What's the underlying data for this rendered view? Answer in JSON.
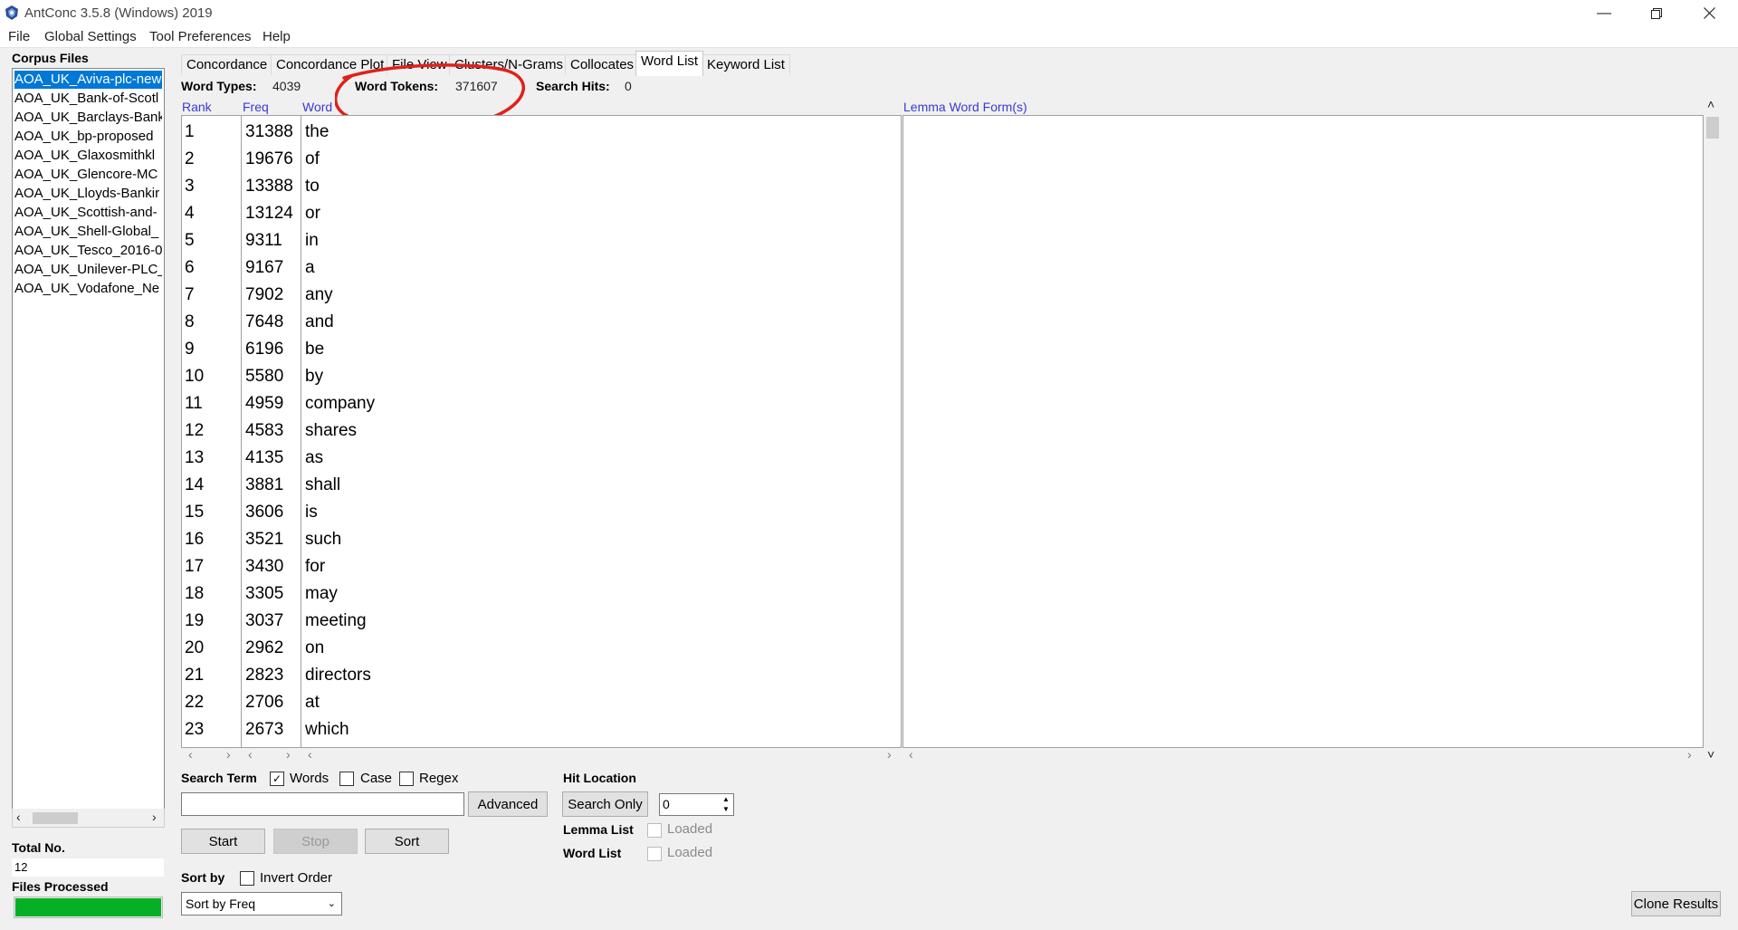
{
  "window": {
    "title": "AntConc 3.5.8 (Windows) 2019",
    "controls": [
      "minimize",
      "restore",
      "close"
    ]
  },
  "menu": [
    "File",
    "Global Settings",
    "Tool Preferences",
    "Help"
  ],
  "corpus": {
    "title": "Corpus Files",
    "files": [
      "AOA_UK_Aviva-plc-new",
      "AOA_UK_Bank-of-Scotl",
      "AOA_UK_Barclays-Bank",
      "AOA_UK_bp-proposed",
      "AOA_UK_Glaxosmithkl",
      "AOA_UK_Glencore-MC",
      "AOA_UK_Lloyds-Bankir",
      "AOA_UK_Scottish-and-",
      "AOA_UK_Shell-Global_",
      "AOA_UK_Tesco_2016-0",
      "AOA_UK_Unilever-PLC_",
      "AOA_UK_Vodafone_Ne"
    ],
    "selected_index": 0,
    "total_label": "Total No.",
    "total_value": "12",
    "files_processed_label": "Files Processed",
    "progress": 1.0
  },
  "tabs": [
    "Concordance",
    "Concordance Plot",
    "File View",
    "Clusters/N-Grams",
    "Collocates",
    "Word List",
    "Keyword List"
  ],
  "active_tab": "Word List",
  "stats": {
    "word_types_label": "Word Types:",
    "word_types_value": "4039",
    "word_tokens_label": "Word Tokens:",
    "word_tokens_value": "371607",
    "search_hits_label": "Search Hits:",
    "search_hits_value": "0"
  },
  "columns": {
    "rank": "Rank",
    "freq": "Freq",
    "word": "Word",
    "lemma": "Lemma Word Form(s)"
  },
  "word_list": [
    {
      "rank": "1",
      "freq": "31388",
      "word": "the"
    },
    {
      "rank": "2",
      "freq": "19676",
      "word": "of"
    },
    {
      "rank": "3",
      "freq": "13388",
      "word": "to"
    },
    {
      "rank": "4",
      "freq": "13124",
      "word": "or"
    },
    {
      "rank": "5",
      "freq": "9311",
      "word": "in"
    },
    {
      "rank": "6",
      "freq": "9167",
      "word": "a"
    },
    {
      "rank": "7",
      "freq": "7902",
      "word": "any"
    },
    {
      "rank": "8",
      "freq": "7648",
      "word": "and"
    },
    {
      "rank": "9",
      "freq": "6196",
      "word": "be"
    },
    {
      "rank": "10",
      "freq": "5580",
      "word": "by"
    },
    {
      "rank": "11",
      "freq": "4959",
      "word": "company"
    },
    {
      "rank": "12",
      "freq": "4583",
      "word": "shares"
    },
    {
      "rank": "13",
      "freq": "4135",
      "word": "as"
    },
    {
      "rank": "14",
      "freq": "3881",
      "word": "shall"
    },
    {
      "rank": "15",
      "freq": "3606",
      "word": "is"
    },
    {
      "rank": "16",
      "freq": "3521",
      "word": "such"
    },
    {
      "rank": "17",
      "freq": "3430",
      "word": "for"
    },
    {
      "rank": "18",
      "freq": "3305",
      "word": "may"
    },
    {
      "rank": "19",
      "freq": "3037",
      "word": "meeting"
    },
    {
      "rank": "20",
      "freq": "2962",
      "word": "on"
    },
    {
      "rank": "21",
      "freq": "2823",
      "word": "directors"
    },
    {
      "rank": "22",
      "freq": "2706",
      "word": "at"
    },
    {
      "rank": "23",
      "freq": "2673",
      "word": "which"
    }
  ],
  "search": {
    "term_label": "Search Term",
    "words_label": "Words",
    "words_checked": true,
    "case_label": "Case",
    "case_checked": false,
    "regex_label": "Regex",
    "regex_checked": false,
    "input_value": "",
    "advanced_label": "Advanced",
    "start_label": "Start",
    "stop_label": "Stop",
    "sort_label": "Sort"
  },
  "hit_location": {
    "label": "Hit Location",
    "search_only_label": "Search Only",
    "value": "0",
    "lemma_list_label": "Lemma List",
    "word_list_label": "Word List",
    "loaded_label": "Loaded"
  },
  "sort": {
    "label": "Sort by",
    "invert_label": "Invert Order",
    "invert_checked": false,
    "selected": "Sort by Freq"
  },
  "clone_results_label": "Clone Results",
  "colors": {
    "selection": "#0078d7",
    "progress": "#06b025",
    "column_header": "#3a3ad0",
    "annotation": "#e0201b"
  }
}
